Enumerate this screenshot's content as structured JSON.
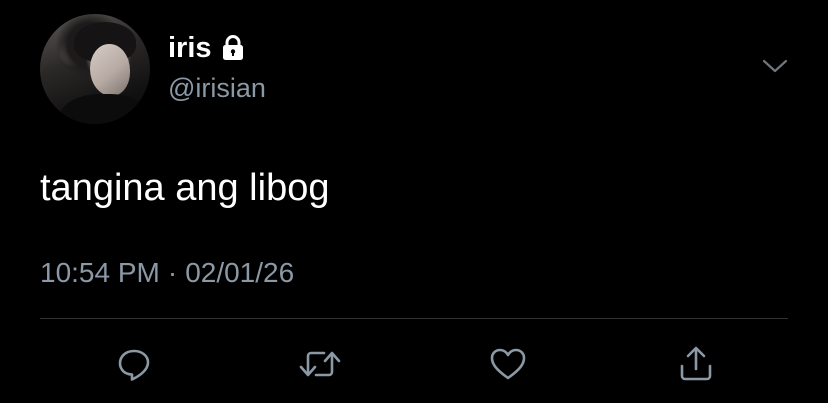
{
  "user": {
    "display_name": "iris",
    "handle": "@irisian",
    "protected": true
  },
  "tweet": {
    "text": "tangina ang libog",
    "time": "10:54 PM",
    "separator": "·",
    "date": "02/01/26"
  },
  "actions": [
    {
      "name": "reply",
      "icon": "reply-icon"
    },
    {
      "name": "retweet",
      "icon": "retweet-icon"
    },
    {
      "name": "like",
      "icon": "heart-icon"
    },
    {
      "name": "share",
      "icon": "share-icon"
    }
  ],
  "colors": {
    "background": "#000000",
    "primary_text": "#ffffff",
    "secondary_text": "#8b98a5",
    "divider": "#2f3336"
  }
}
